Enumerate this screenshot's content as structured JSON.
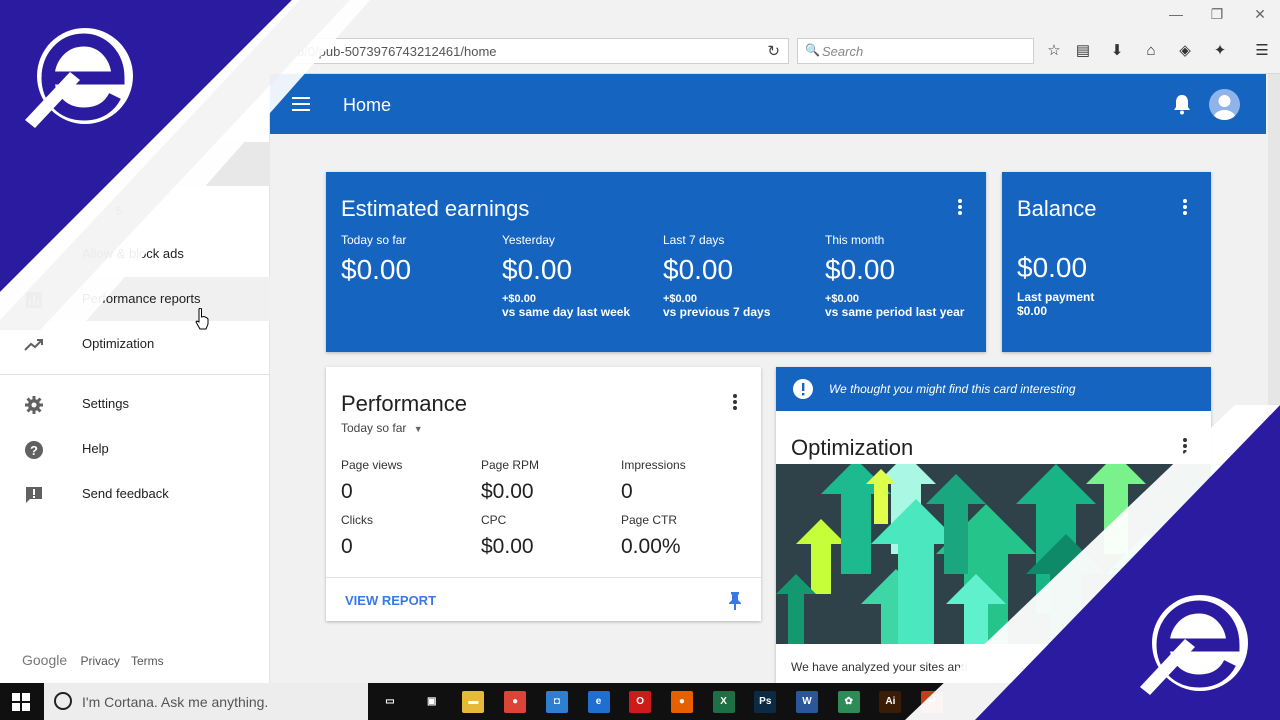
{
  "browser": {
    "url": "u/0/pub-5073976743212461/home",
    "search_placeholder": "Search",
    "window_controls": [
      "minimize-icon",
      "restore-icon",
      "close-icon"
    ],
    "toolbar_icons": [
      "star-icon",
      "reading-list-icon",
      "download-icon",
      "home-icon",
      "pocket-icon",
      "extension-icon",
      "menu-icon"
    ]
  },
  "sidebar": {
    "partial_label": "s",
    "items": [
      {
        "label": "Allow & block ads",
        "icon": "block-icon"
      },
      {
        "label": "Performance reports",
        "icon": "bar-chart-icon"
      },
      {
        "label": "Optimization",
        "icon": "trending-up-icon"
      },
      {
        "label": "Settings",
        "icon": "gear-icon"
      },
      {
        "label": "Help",
        "icon": "help-icon"
      },
      {
        "label": "Send feedback",
        "icon": "feedback-icon"
      }
    ],
    "footer": {
      "brand": "Google",
      "privacy": "Privacy",
      "terms": "Terms"
    }
  },
  "appbar": {
    "title": "Home"
  },
  "earnings": {
    "title": "Estimated earnings",
    "stats": [
      {
        "label": "Today so far",
        "value": "$0.00",
        "delta": "",
        "compare": ""
      },
      {
        "label": "Yesterday",
        "value": "$0.00",
        "delta": "+$0.00",
        "compare": "vs same day last week"
      },
      {
        "label": "Last 7 days",
        "value": "$0.00",
        "delta": "+$0.00",
        "compare": "vs previous 7 days"
      },
      {
        "label": "This month",
        "value": "$0.00",
        "delta": "+$0.00",
        "compare": "vs same period last year"
      }
    ]
  },
  "balance": {
    "title": "Balance",
    "value": "$0.00",
    "last_payment_label": "Last payment",
    "last_payment_value": "$0.00"
  },
  "performance": {
    "title": "Performance",
    "period": "Today so far",
    "metrics": [
      {
        "label": "Page views",
        "value": "0"
      },
      {
        "label": "Page RPM",
        "value": "$0.00"
      },
      {
        "label": "Impressions",
        "value": "0"
      },
      {
        "label": "Clicks",
        "value": "0"
      },
      {
        "label": "CPC",
        "value": "$0.00"
      },
      {
        "label": "Page CTR",
        "value": "0.00%"
      }
    ],
    "action": "VIEW REPORT"
  },
  "optimization": {
    "banner": "We thought you might find this card interesting",
    "title": "Optimization",
    "description": "We have analyzed your sites and"
  },
  "taskbar": {
    "cortana_placeholder": "I'm Cortana. Ask me anything.",
    "apps": [
      {
        "name": "task-view-icon",
        "color": "#101010",
        "glyph": "▭"
      },
      {
        "name": "store-icon",
        "color": "#101010",
        "glyph": "▣"
      },
      {
        "name": "file-explorer-icon",
        "color": "#e8b838",
        "glyph": "▬"
      },
      {
        "name": "chrome-icon",
        "color": "#db4437",
        "glyph": "●"
      },
      {
        "name": "app-icon",
        "color": "#2f7fd1",
        "glyph": "◘"
      },
      {
        "name": "edge-icon",
        "color": "#1f6fd1",
        "glyph": "e"
      },
      {
        "name": "opera-icon",
        "color": "#cc1b1b",
        "glyph": "O"
      },
      {
        "name": "firefox-icon",
        "color": "#e66000",
        "glyph": "●"
      },
      {
        "name": "excel-icon",
        "color": "#1d7044",
        "glyph": "X"
      },
      {
        "name": "photoshop-icon",
        "color": "#0b2b45",
        "glyph": "Ps"
      },
      {
        "name": "word-icon",
        "color": "#2b579a",
        "glyph": "W"
      },
      {
        "name": "app-green-icon",
        "color": "#2e8b57",
        "glyph": "✿"
      },
      {
        "name": "illustrator-icon",
        "color": "#3b1c05",
        "glyph": "Ai"
      },
      {
        "name": "powerpoint-icon",
        "color": "#c43e1c",
        "glyph": "P"
      }
    ]
  }
}
